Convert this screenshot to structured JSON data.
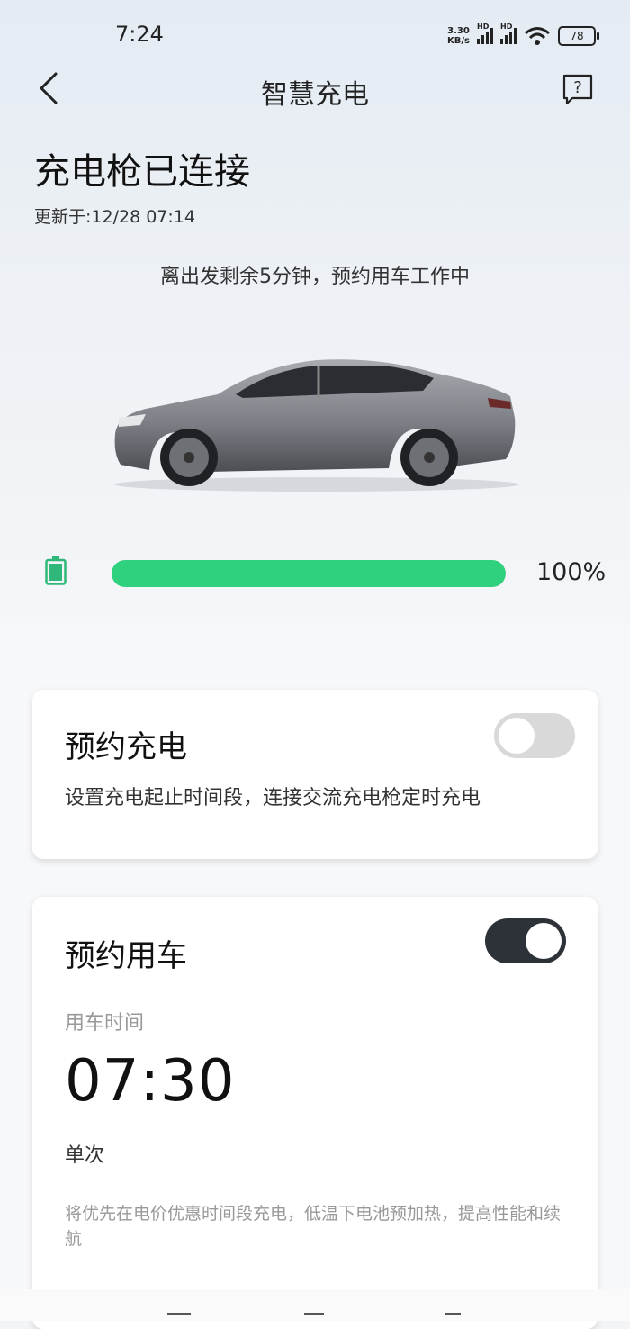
{
  "status_bar": {
    "time": "7:24",
    "net_speed_value": "3.30",
    "net_speed_unit": "KB/s",
    "signal_badge": "HD",
    "battery": "78"
  },
  "header": {
    "title": "智慧充电"
  },
  "charging": {
    "title": "充电枪已连接",
    "updated": "更新于:12/28 07:14",
    "status_message": "离出发剩余5分钟，预约用车工作中",
    "battery_level": 1.0,
    "battery_percent": "100%",
    "accent_color": "#2fd07e"
  },
  "reserve_charge": {
    "title": "预约充电",
    "description": "设置充电起止时间段，连接交流充电枪定时充电",
    "enabled": false
  },
  "reserve_vehicle": {
    "title": "预约用车",
    "enabled": true,
    "time_label": "用车时间",
    "time": "07:30",
    "frequency": "单次",
    "note": "将优先在电价优惠时间段充电，低温下电池预加热，提高性能和续航"
  },
  "icons": [
    "back-icon",
    "help-icon",
    "battery-icon",
    "signal-icon",
    "wifi-icon"
  ]
}
